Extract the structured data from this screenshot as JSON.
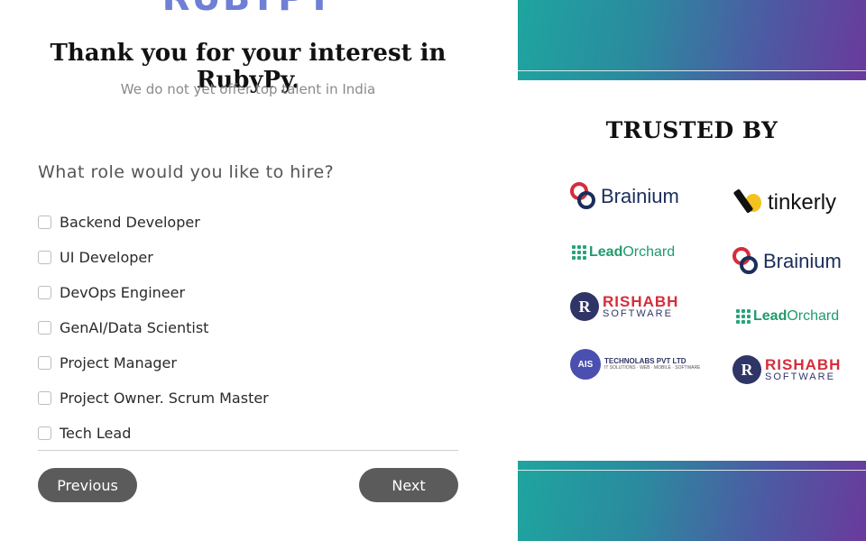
{
  "brand": {
    "logo_text": "RUBYPY"
  },
  "header": {
    "title": "Thank you for your interest in RubyPy.",
    "subtitle": "We do not yet offer top talent in India"
  },
  "form": {
    "question": "What role would you like to hire?",
    "options": [
      {
        "label": "Backend Developer",
        "checked": false
      },
      {
        "label": "UI Developer",
        "checked": false
      },
      {
        "label": "DevOps Engineer",
        "checked": false
      },
      {
        "label": "GenAI/Data Scientist",
        "checked": false
      },
      {
        "label": "Project Manager",
        "checked": false
      },
      {
        "label": "Project Owner. Scrum Master",
        "checked": false
      },
      {
        "label": "Tech Lead",
        "checked": false
      }
    ],
    "previous_label": "Previous",
    "next_label": "Next"
  },
  "trusted": {
    "heading": "TRUSTED BY",
    "logos": {
      "brainium": "Brainium",
      "tinkerly": "tinkerly",
      "lead": "Lead",
      "orchard": "Orchard",
      "rishabh_mark": "R",
      "rishabh": "RISHABH",
      "rishabh_sub": "SOFTWARE",
      "ais_mark": "AIS",
      "ais_name": "TECHNOLABS PVT LTD",
      "ais_tagline": "IT SOLUTIONS · WEB · MOBILE · SOFTWARE"
    }
  },
  "colors": {
    "button_bg": "#5b5b5b",
    "banner_start": "#1ea59f",
    "banner_end": "#6a3a9c"
  }
}
